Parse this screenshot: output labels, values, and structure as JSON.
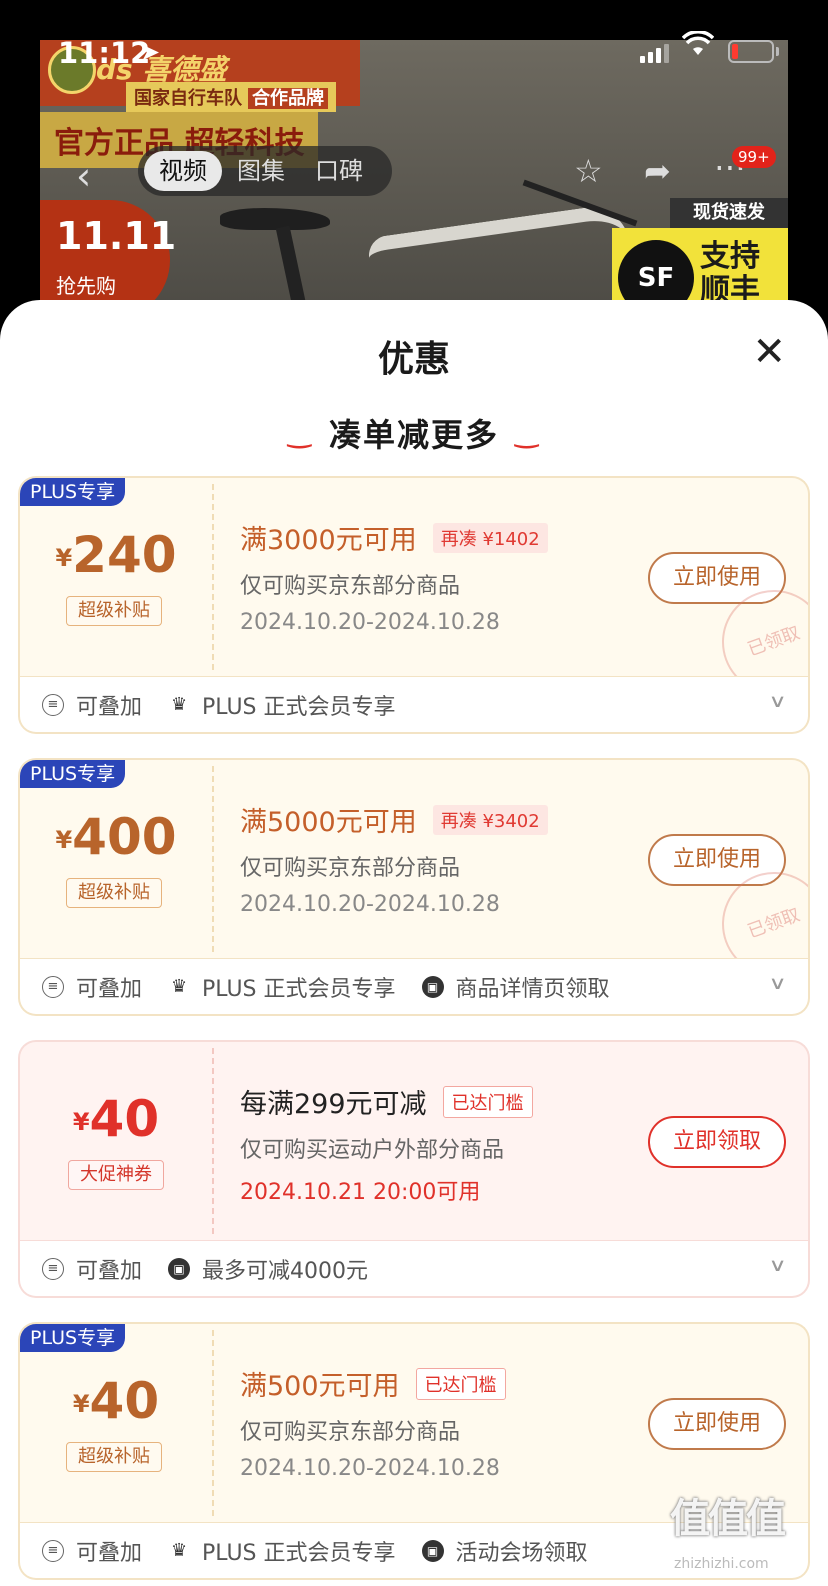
{
  "status_bar": {
    "time": "11:12",
    "location_arrow": "➤",
    "wifi": "wifi-icon",
    "battery_level": 0.15
  },
  "background": {
    "brand": "ds 喜德盛",
    "partner": "国家自行车队",
    "partner_tag": "合作品牌",
    "slogan": "官方正品 超轻科技",
    "promo_num": "11.11",
    "promo_text": "抢先购",
    "express": "现货速发",
    "sf_logo": "SF",
    "sf_text1": "支持",
    "sf_text2": "顺丰",
    "tabs": [
      "视频",
      "图集",
      "口碑"
    ],
    "badge": "99+"
  },
  "sheet": {
    "title": "优惠",
    "close": "✕",
    "section_title": "凑单减更多"
  },
  "coupons": [
    {
      "tag": "PLUS专享",
      "currency": "¥",
      "amount": "240",
      "amount_tag": "超级补贴",
      "condition": "满3000元可用",
      "chip": "再凑 ¥1402",
      "scope": "仅可购买京东部分商品",
      "date": "2024.10.20-2024.10.28",
      "button": "立即使用",
      "stamp": "已领取",
      "features": [
        "可叠加",
        "PLUS 正式会员专享"
      ]
    },
    {
      "tag": "PLUS专享",
      "currency": "¥",
      "amount": "400",
      "amount_tag": "超级补贴",
      "condition": "满5000元可用",
      "chip": "再凑 ¥3402",
      "scope": "仅可购买京东部分商品",
      "date": "2024.10.20-2024.10.28",
      "button": "立即使用",
      "stamp": "已领取",
      "features": [
        "可叠加",
        "PLUS 正式会员专享",
        "商品详情页领取"
      ]
    },
    {
      "currency": "¥",
      "amount": "40",
      "amount_tag": "大促神券",
      "condition": "每满299元可减",
      "chip": "已达门槛",
      "scope": "仅可购买运动户外部分商品",
      "date": "2024.10.21 20:00可用",
      "button": "立即领取",
      "features": [
        "可叠加",
        "最多可减4000元"
      ]
    },
    {
      "tag": "PLUS专享",
      "currency": "¥",
      "amount": "40",
      "amount_tag": "超级补贴",
      "condition": "满500元可用",
      "chip": "已达门槛",
      "scope": "仅可购买京东部分商品",
      "date": "2024.10.20-2024.10.28",
      "button": "立即使用",
      "features": [
        "可叠加",
        "PLUS 正式会员专享",
        "活动会场领取"
      ]
    }
  ],
  "watermark": {
    "text": "值值值",
    "url": "zhizhizhi.com"
  },
  "colors": {
    "accent_red": "#e0312a",
    "plus_blue": "#2b45b8",
    "coupon_gold": "#b8642b"
  }
}
